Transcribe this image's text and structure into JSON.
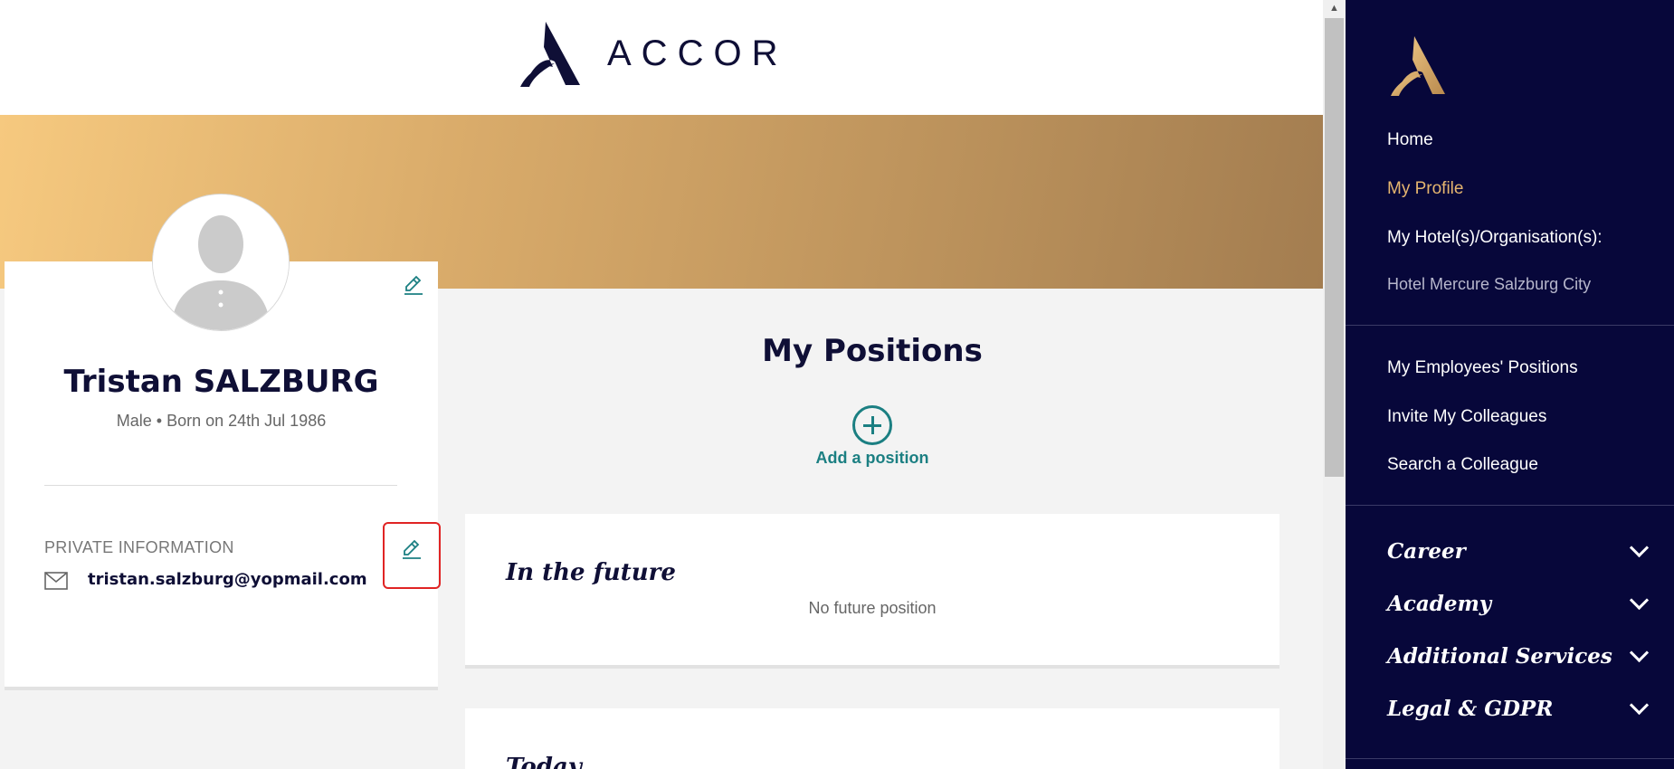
{
  "header": {
    "brand": "ACCOR"
  },
  "profile": {
    "name": "Tristan SALZBURG",
    "meta": "Male • Born on 24th Jul 1986",
    "private_title": "PRIVATE INFORMATION",
    "email": "tristan.salzburg@yopmail.com"
  },
  "positions": {
    "title": "My Positions",
    "add_label": "Add a position",
    "future_title": "In the future",
    "future_empty": "No future position",
    "today_title": "Today"
  },
  "sidebar": {
    "items": [
      {
        "label": "Home"
      },
      {
        "label": "My Profile",
        "active": true
      },
      {
        "label": "My Hotel(s)/Organisation(s):"
      },
      {
        "label": "Hotel Mercure Salzburg City"
      },
      {
        "label": "My Employees' Positions"
      },
      {
        "label": "Invite My Colleagues"
      },
      {
        "label": "Search a Colleague"
      }
    ],
    "sections": [
      {
        "label": "Career"
      },
      {
        "label": "Academy"
      },
      {
        "label": "Additional Services"
      },
      {
        "label": "Legal & GDPR"
      }
    ]
  },
  "colors": {
    "navy": "#0f0f36",
    "teal": "#1b7f82",
    "gold": "#e5b56f",
    "sidebar_bg": "#07073a"
  }
}
